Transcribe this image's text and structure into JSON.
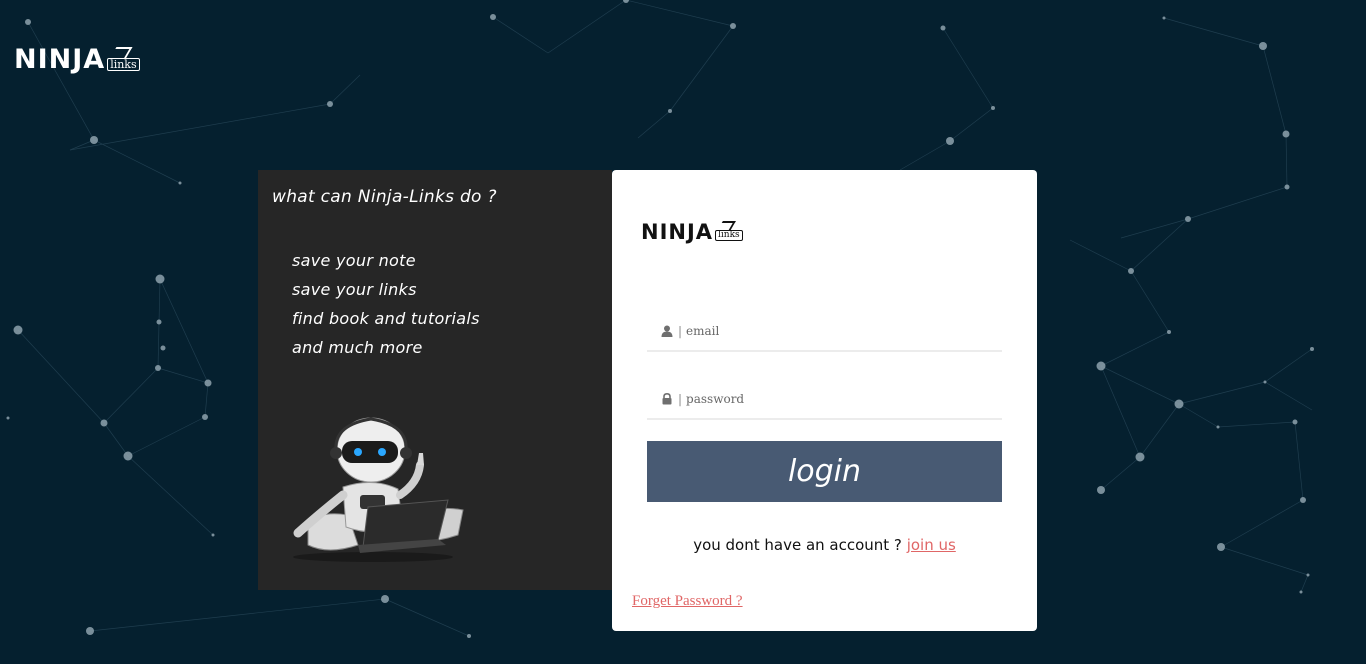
{
  "brand": {
    "logo_word": "NINJA",
    "logo_sub": "links"
  },
  "info_panel": {
    "title": "what can Ninja-Links do ?",
    "features": [
      "save your note",
      "save your links",
      "find book and tutorials",
      "and much more"
    ]
  },
  "login": {
    "email_placeholder": "email",
    "password_placeholder": "password",
    "field_separator": "|",
    "login_label": "login",
    "signup_prompt": "you dont have an account ?",
    "signup_link": "join us",
    "forgot_link": "Forget Password ?"
  },
  "colors": {
    "background": "#05202f",
    "panel": "#262626",
    "button": "#485a73",
    "link": "#e06666"
  },
  "icons": [
    "user-icon",
    "lock-icon",
    "robot-illustration"
  ]
}
